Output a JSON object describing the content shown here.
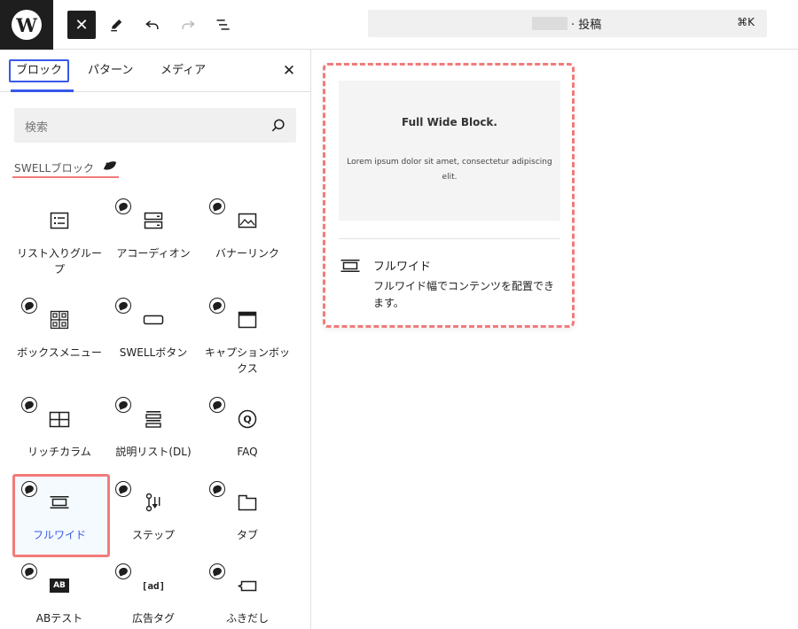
{
  "toolbar": {
    "logo_glyph": "W",
    "close_glyph": "✕",
    "command_bar": {
      "title": "· 投稿",
      "shortcut": "⌘K"
    }
  },
  "inserter": {
    "tabs": [
      "ブロック",
      "パターン",
      "メディア"
    ],
    "close_glyph": "✕",
    "search_placeholder": "検索",
    "category_title": "SWELLブロック",
    "blocks": [
      {
        "label": "リスト入りグループ",
        "icon": "list-group-icon",
        "swell_badge": false
      },
      {
        "label": "アコーディオン",
        "icon": "accordion-icon",
        "swell_badge": true
      },
      {
        "label": "バナーリンク",
        "icon": "banner-link-icon",
        "swell_badge": true
      },
      {
        "label": "ボックスメニュー",
        "icon": "box-menu-icon",
        "swell_badge": true
      },
      {
        "label": "SWELLボタン",
        "icon": "button-icon",
        "swell_badge": true
      },
      {
        "label": "キャプションボックス",
        "icon": "caption-box-icon",
        "swell_badge": true
      },
      {
        "label": "リッチカラム",
        "icon": "rich-column-icon",
        "swell_badge": true
      },
      {
        "label": "説明リスト(DL)",
        "icon": "description-list-icon",
        "swell_badge": true
      },
      {
        "label": "FAQ",
        "icon": "faq-icon",
        "swell_badge": true
      },
      {
        "label": "フルワイド",
        "icon": "full-wide-icon",
        "swell_badge": true,
        "selected": true
      },
      {
        "label": "ステップ",
        "icon": "step-icon",
        "swell_badge": true
      },
      {
        "label": "タブ",
        "icon": "tab-icon",
        "swell_badge": true
      },
      {
        "label": "ABテスト",
        "icon": "ab-test-icon",
        "swell_badge": true,
        "icon_text": "AB"
      },
      {
        "label": "広告タグ",
        "icon": "ad-tag-icon",
        "swell_badge": true,
        "icon_text": "[ad]"
      },
      {
        "label": "ふきだし",
        "icon": "balloon-icon",
        "swell_badge": true
      }
    ]
  },
  "preview": {
    "example_title": "Full Wide Block.",
    "example_text": "Lorem ipsum dolor sit amet, consectetur adipiscing elit.",
    "block_name": "フルワイド",
    "block_description": "フルワイド幅でコンテンツを配置できます。"
  },
  "colors": {
    "accent": "#3858e9",
    "highlight": "#f27b7b",
    "dark": "#1e1e1e"
  }
}
